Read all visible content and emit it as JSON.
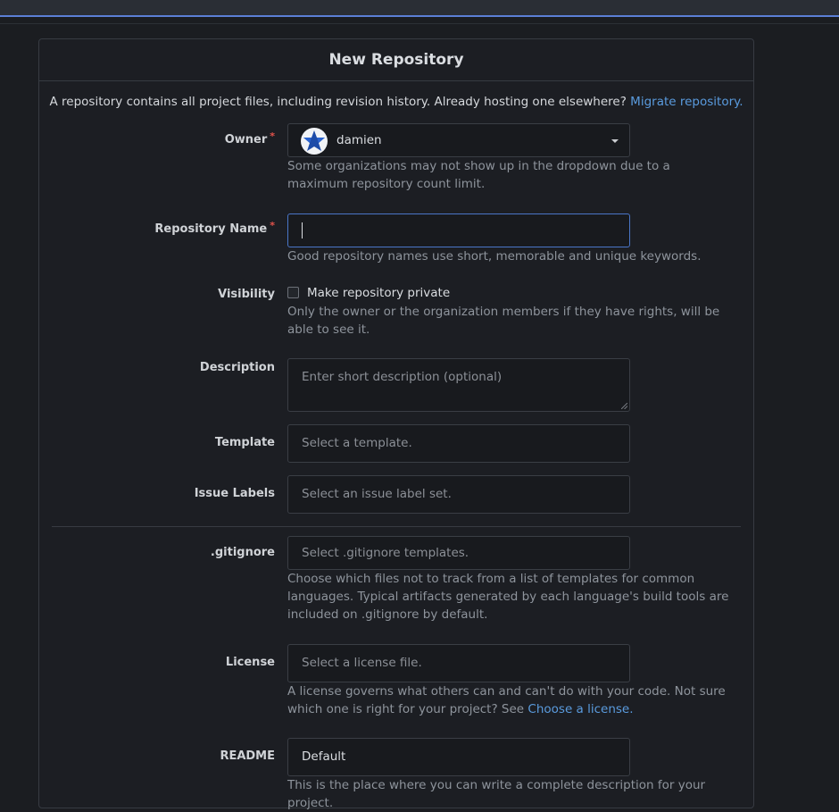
{
  "page": {
    "title": "New Repository",
    "intro_text": "A repository contains all project files, including revision history. Already hosting one elsewhere?",
    "intro_link": "Migrate repository."
  },
  "owner": {
    "label": "Owner",
    "required_mark": "*",
    "value": "damien",
    "help": "Some organizations may not show up in the dropdown due to a maximum repository count limit."
  },
  "repo_name": {
    "label": "Repository Name",
    "required_mark": "*",
    "value": "",
    "help": "Good repository names use short, memorable and unique keywords."
  },
  "visibility": {
    "label": "Visibility",
    "checkbox_label": "Make repository private",
    "checked": false,
    "help": "Only the owner or the organization members if they have rights, will be able to see it."
  },
  "description": {
    "label": "Description",
    "placeholder": "Enter short description (optional)"
  },
  "template": {
    "label": "Template",
    "placeholder": "Select a template."
  },
  "issue_labels": {
    "label": "Issue Labels",
    "placeholder": "Select an issue label set."
  },
  "gitignore": {
    "label": ".gitignore",
    "placeholder": "Select .gitignore templates.",
    "help": "Choose which files not to track from a list of templates for common languages. Typical artifacts generated by each language's build tools are included on .gitignore by default."
  },
  "license": {
    "label": "License",
    "placeholder": "Select a license file.",
    "help_text": "A license governs what others can and can't do with your code. Not sure which one is right for your project? See",
    "help_link": "Choose a license."
  },
  "readme": {
    "label": "README",
    "value": "Default",
    "help": "This is the place where you can write a complete description for your project."
  },
  "colors": {
    "accent": "#5a9bde",
    "required": "#e5534b",
    "focus_border": "#4a76c8"
  }
}
